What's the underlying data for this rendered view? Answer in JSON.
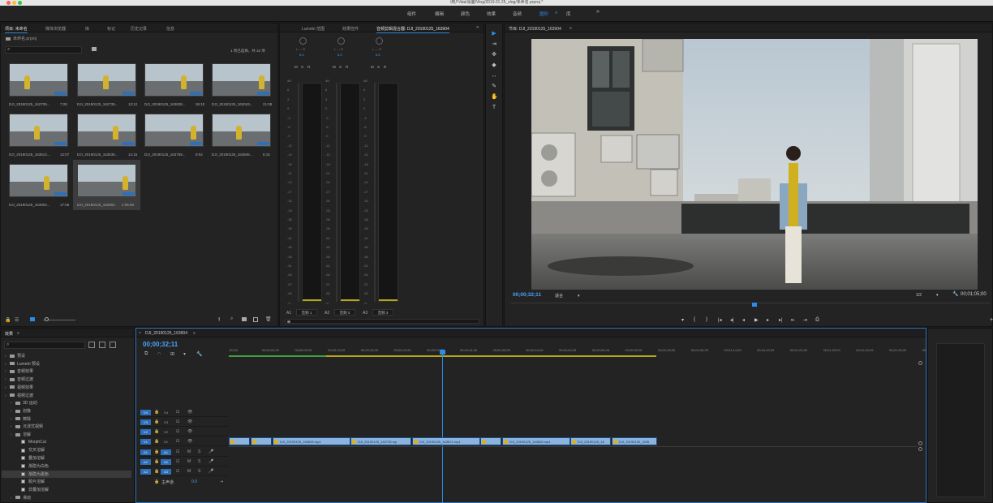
{
  "window_title": "/用户/dai/桌面/Vlog/2019.01.25_vlog/未命名.prproj *",
  "workspaces": [
    {
      "label": "组件",
      "active": false
    },
    {
      "label": "编辑",
      "active": false
    },
    {
      "label": "颜色",
      "active": false
    },
    {
      "label": "效果",
      "active": false
    },
    {
      "label": "音频",
      "active": false
    },
    {
      "label": "图形",
      "active": true
    },
    {
      "label": "库",
      "active": false
    }
  ],
  "workspace_more": "»",
  "project": {
    "tabs": [
      "项目: 未命名",
      "媒体浏览器",
      "库",
      "标记",
      "历史记录",
      "信息"
    ],
    "file": "未命名.prproj",
    "status": "1 项已选择，共 10 项",
    "items": [
      {
        "name": "DJI_20190125_162709...",
        "dur": "7:28"
      },
      {
        "name": "DJI_20190125_162735...",
        "dur": "13:12"
      },
      {
        "name": "DJI_20190125_163838...",
        "dur": "36:10"
      },
      {
        "name": "DJI_20190125_163043...",
        "dur": "21:08"
      },
      {
        "name": "DJI_20190125_163513...",
        "dur": "12:07"
      },
      {
        "name": "DJI_20190125_163635...",
        "dur": "14:15"
      },
      {
        "name": "DJI_20190125_163759...",
        "dur": "9:04"
      },
      {
        "name": "DJI_20190125_163846...",
        "dur": "6:15"
      },
      {
        "name": "DJI_20190125_163904...",
        "dur": "17:05"
      },
      {
        "name": "DJI_20190125_163904",
        "dur": "1:05:00"
      }
    ]
  },
  "mixer": {
    "tabs": [
      "Lumetri 范围",
      "效果控件",
      "音频剪辑混合器: DJI_20190125_163904"
    ],
    "more": "»",
    "channels": [
      {
        "id": "A1",
        "name": "音频 1"
      },
      {
        "id": "A2",
        "name": "音频 2"
      },
      {
        "id": "A3",
        "name": "音频 3"
      }
    ],
    "knob_label": "L — R",
    "knob_value": "0.0",
    "msr": [
      "M",
      "S",
      "R"
    ],
    "db_scale": [
      "dB",
      "6",
      "3",
      "0",
      "-3",
      "-6",
      "-9",
      "-12",
      "-15",
      "-18",
      "-21",
      "-24",
      "-27",
      "-30",
      "-33",
      "-36",
      "-39",
      "-42",
      "-45",
      "-48",
      "-51",
      "-54",
      "-57",
      "-60",
      "-∞"
    ]
  },
  "tools": [
    "▶",
    "⇥",
    "✥",
    "◆",
    "↔",
    "✎",
    "✋",
    "T"
  ],
  "program": {
    "title": "节目: DJI_20190125_163904",
    "timecode": "00;00;32;11",
    "fit": "适合",
    "res": "1/2",
    "end_timecode": "00;01;05;00",
    "controls": [
      "▾",
      "{",
      "}",
      "|◂",
      "◂|",
      "◂",
      "▶",
      "▸",
      "▸|",
      "⇤",
      "⇥",
      "⎙"
    ]
  },
  "effects": {
    "title": "效果",
    "tree": [
      {
        "label": "预设",
        "type": "folder",
        "depth": 0
      },
      {
        "label": "Lumetri 预设",
        "type": "folder",
        "depth": 0
      },
      {
        "label": "音频效果",
        "type": "folder",
        "depth": 0
      },
      {
        "label": "音频过渡",
        "type": "folder",
        "depth": 0
      },
      {
        "label": "视频效果",
        "type": "folder",
        "depth": 0
      },
      {
        "label": "视频过渡",
        "type": "folder",
        "depth": 0
      },
      {
        "label": "3D 运动",
        "type": "folder",
        "depth": 1
      },
      {
        "label": "划像",
        "type": "folder",
        "depth": 1
      },
      {
        "label": "擦除",
        "type": "folder",
        "depth": 1
      },
      {
        "label": "沉浸式视频",
        "type": "folder",
        "depth": 1
      },
      {
        "label": "溶解",
        "type": "folder",
        "depth": 1
      },
      {
        "label": "MorphCut",
        "type": "fx",
        "depth": 2
      },
      {
        "label": "交叉溶解",
        "type": "fx",
        "depth": 2
      },
      {
        "label": "叠加溶解",
        "type": "fx",
        "depth": 2
      },
      {
        "label": "渐隐为白色",
        "type": "fx",
        "depth": 2
      },
      {
        "label": "渐隐为黑色",
        "type": "fx",
        "depth": 2,
        "selected": true
      },
      {
        "label": "胶片溶解",
        "type": "fx",
        "depth": 2
      },
      {
        "label": "非叠加溶解",
        "type": "fx",
        "depth": 2
      },
      {
        "label": "滑动",
        "type": "folder",
        "depth": 1
      }
    ]
  },
  "timeline": {
    "title": "DJI_20190125_163904",
    "timecode": "00;00;32;11",
    "ruler": [
      ";00;00",
      "00;00;04;29",
      "00;00;09;29",
      "00;00;14;29",
      "00;00;19;29",
      "00;00;24;29",
      "00;00;29;29",
      "00;00;34;28",
      "00;00;39;28",
      "00;00;44;28",
      "00;00;49;28",
      "00;00;54;28",
      "00;00;59;28",
      "00;01;05;00",
      "00;01;09;29",
      "00;01;14;29",
      "00;01;19;29",
      "00;01;24;29",
      "00;01;29;29",
      "00;01;34;29",
      "00;01;39;29",
      "00;"
    ],
    "video_tracks": [
      {
        "src": "V4",
        "name": "V4"
      },
      {
        "src": "V3",
        "name": "V3"
      },
      {
        "src": "V2",
        "name": "V2"
      },
      {
        "src": "V1",
        "name": "V1"
      }
    ],
    "audio_tracks": [
      {
        "src": "A1",
        "name": "A1"
      },
      {
        "src": "A2",
        "name": "A2"
      },
      {
        "src": "A3",
        "name": "A3"
      }
    ],
    "master": {
      "label": "主声道",
      "value": "0.0"
    },
    "clips": [
      "",
      "",
      "DJI_20190125_163608.mp4",
      "DJI_20190125_162735.mp",
      "DJI_20190125_163513.mp4",
      "",
      "DJI_20190125_163635.mp4",
      "DJI_20190125_16",
      "DJI_20190125_1638"
    ]
  }
}
